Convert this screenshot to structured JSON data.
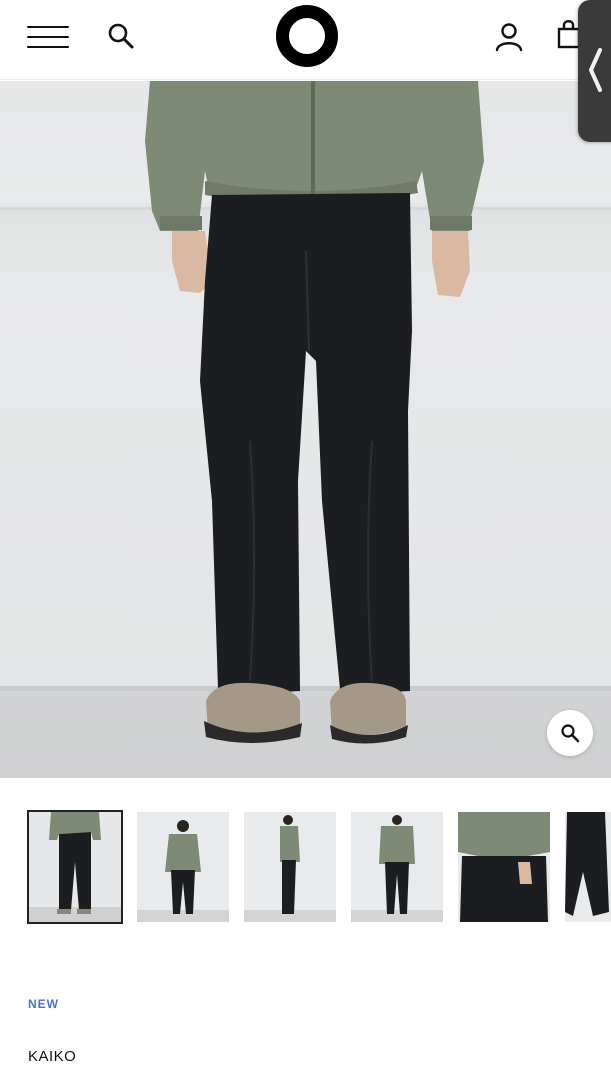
{
  "header": {
    "menu_icon": "hamburger-menu-icon",
    "search_icon": "search-icon",
    "logo_icon": "ring-logo",
    "account_icon": "user-icon",
    "cart_icon": "shopping-bag-icon",
    "side_tab_icon": "chevron-left-icon"
  },
  "gallery": {
    "zoom_icon": "magnifier-icon",
    "thumbnail_count": 6,
    "active_thumbnail": 1
  },
  "product": {
    "badge": "NEW",
    "brand": "KAIKO"
  },
  "colors": {
    "badge_accent": "#4a6fd6",
    "jacket": "#7d8a76",
    "trousers": "#1b1d20",
    "shoes": "#a49886",
    "wall": "#e6e7e8",
    "floor": "#cfd0d1"
  }
}
